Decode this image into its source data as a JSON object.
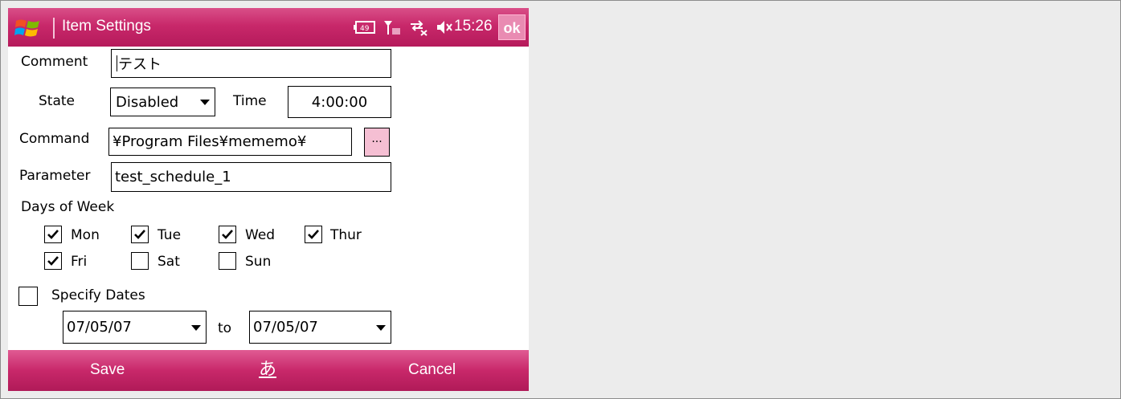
{
  "window": {
    "title": "Item Settings",
    "clock": "15:26",
    "ok_label": "ok"
  },
  "form": {
    "comment_label": "Comment",
    "comment_value": "テスト",
    "state_label": "State",
    "state_value": "Disabled",
    "time_label": "Time",
    "time_value": "4:00:00",
    "command_label": "Command",
    "command_value": "¥Program Files¥mememo¥",
    "browse_label": "...",
    "parameter_label": "Parameter",
    "parameter_value": "test_schedule_1",
    "days_label": "Days of Week",
    "days": [
      {
        "label": "Mon",
        "checked": true
      },
      {
        "label": "Tue",
        "checked": true
      },
      {
        "label": "Wed",
        "checked": true
      },
      {
        "label": "Thur",
        "checked": true
      },
      {
        "label": "Fri",
        "checked": true
      },
      {
        "label": "Sat",
        "checked": false
      },
      {
        "label": "Sun",
        "checked": false
      }
    ],
    "specify_dates_label": "Specify Dates",
    "specify_dates_checked": false,
    "date_from": "07/05/07",
    "to_label": "to",
    "date_to": "07/05/07"
  },
  "softbar": {
    "left_label": "Save",
    "ime_label": "あ",
    "right_label": "Cancel"
  },
  "colors": {
    "accent": "#c8286a",
    "browse_button": "#f5bfd3"
  }
}
